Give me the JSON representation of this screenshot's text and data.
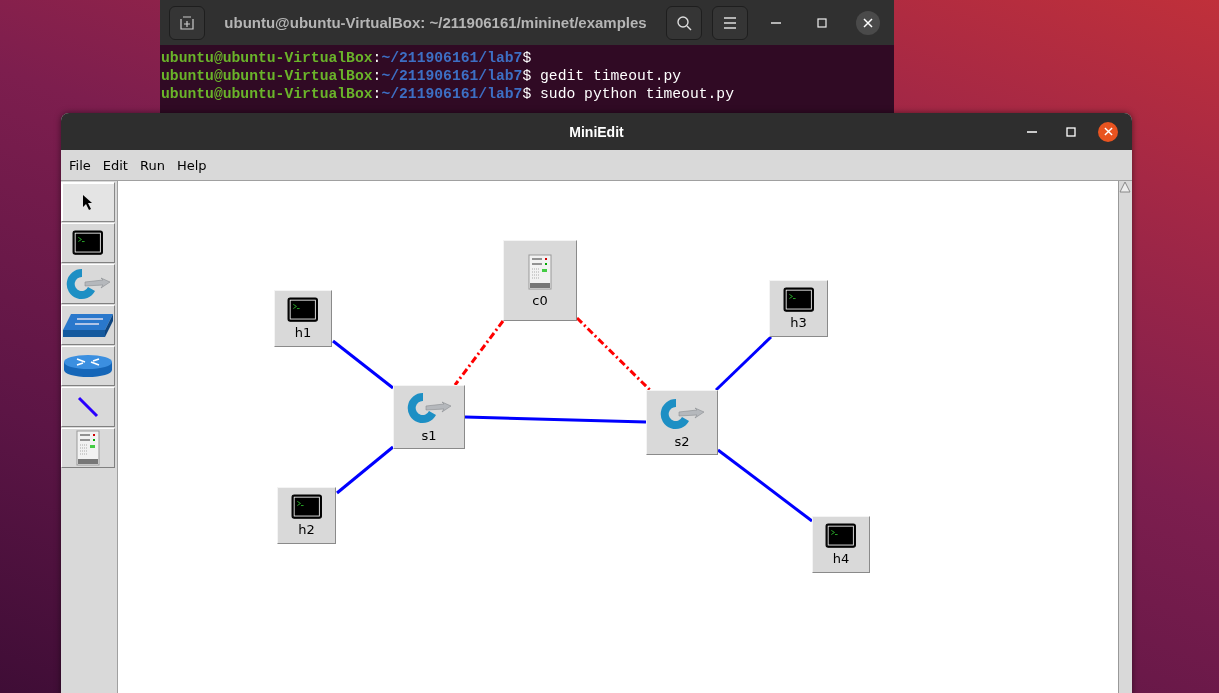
{
  "terminal": {
    "title": "ubuntu@ubuntu-VirtualBox: ~/211906161/mininet/examples",
    "lines": [
      {
        "user": "ubuntu@ubuntu-VirtualBox",
        "separator": ":",
        "path": "~/211906161/lab7",
        "prompt": "$"
      },
      {
        "user": "ubuntu@ubuntu-VirtualBox",
        "separator": ":",
        "path": "~/211906161/lab7",
        "prompt": "$",
        "command": "gedit timeout.py"
      },
      {
        "user": "ubuntu@ubuntu-VirtualBox",
        "separator": ":",
        "path": "~/211906161/lab7",
        "prompt": "$",
        "command": "sudo python timeout.py"
      }
    ]
  },
  "window": {
    "title": "MiniEdit"
  },
  "menu": [
    "File",
    "Edit",
    "Run",
    "Help"
  ],
  "tools": [
    {
      "kind": "select",
      "selected": true
    },
    {
      "kind": "host",
      "selected": false
    },
    {
      "kind": "switch",
      "selected": false
    },
    {
      "kind": "legacy-switch",
      "selected": false
    },
    {
      "kind": "router",
      "selected": false
    },
    {
      "kind": "link",
      "selected": false
    },
    {
      "kind": "controller",
      "selected": false
    }
  ],
  "nodes": [
    {
      "kind": "controller",
      "label": "c0"
    },
    {
      "kind": "host",
      "label": "h1"
    },
    {
      "kind": "host",
      "label": "h3"
    },
    {
      "kind": "switch",
      "label": "s1"
    },
    {
      "kind": "switch",
      "label": "s2"
    },
    {
      "kind": "host",
      "label": "h2"
    },
    {
      "kind": "host",
      "label": "h4"
    }
  ],
  "links": [
    {
      "kind": "data"
    },
    {
      "kind": "data"
    },
    {
      "kind": "data"
    },
    {
      "kind": "data"
    },
    {
      "kind": "data"
    },
    {
      "kind": "control"
    },
    {
      "kind": "control"
    }
  ]
}
